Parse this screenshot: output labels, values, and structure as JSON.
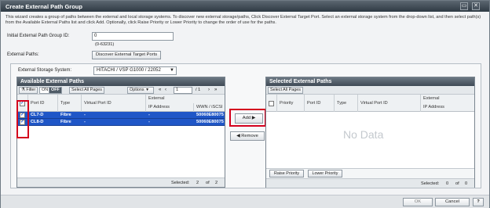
{
  "window": {
    "title": "Create External Path Group",
    "description": "This wizard creates a group of paths between the external and local storage systems. To discover new external storage/paths, Click Discover External Target Port. Select an external storage system from the drop-down list, and then select path(s) from the Available External Paths list and click Add. Optionally, click Raise Priority or Lower Priority to change the order of use for the paths."
  },
  "group_id": {
    "label": "Initial External Path Group ID:",
    "value": "0",
    "hint": "(0-63231)"
  },
  "external_paths": {
    "label": "External Paths:",
    "discover_label": "Discover External Target Ports"
  },
  "storage": {
    "label": "External Storage System:",
    "selected": "HITACHI / VSP G1000 / 22052"
  },
  "available": {
    "title": "Available External Paths",
    "toolbar": {
      "filter": "Filter",
      "on": "ON",
      "off": "OFF",
      "select_all": "Select All Pages",
      "options": "Options",
      "page": "1",
      "page_total": "/ 1"
    },
    "columns": {
      "port_id": "Port ID",
      "type": "Type",
      "virtual_port_id": "Virtual Port ID",
      "external": "External",
      "ip_address": "IP Address",
      "wwn": "WWN / iSCSI"
    },
    "rows": [
      {
        "port_id": "CL7-D",
        "type": "Fibre",
        "virtual_port_id": "-",
        "ip_address": "-",
        "wwn": "50060E80075"
      },
      {
        "port_id": "CL8-D",
        "type": "Fibre",
        "virtual_port_id": "-",
        "ip_address": "-",
        "wwn": "50060E80075"
      }
    ],
    "footer": {
      "selected_label": "Selected:",
      "selected_count": "2",
      "of": "of",
      "total": "2"
    }
  },
  "transfer": {
    "add_label": "Add",
    "remove_label": "Remove"
  },
  "selected": {
    "title": "Selected External Paths",
    "select_all": "Select All Pages",
    "columns": {
      "priority": "Priority",
      "port_id": "Port ID",
      "type": "Type",
      "virtual_port_id": "Virtual Port ID",
      "external": "External",
      "ip_address": "IP Address"
    },
    "empty_text": "No Data",
    "raise_label": "Raise Priority",
    "lower_label": "Lower Priority",
    "footer": {
      "selected_label": "Selected:",
      "selected_count": "0",
      "of": "of",
      "total": "0"
    }
  },
  "buttons": {
    "ok": "OK",
    "cancel": "Cancel",
    "help": "?"
  }
}
